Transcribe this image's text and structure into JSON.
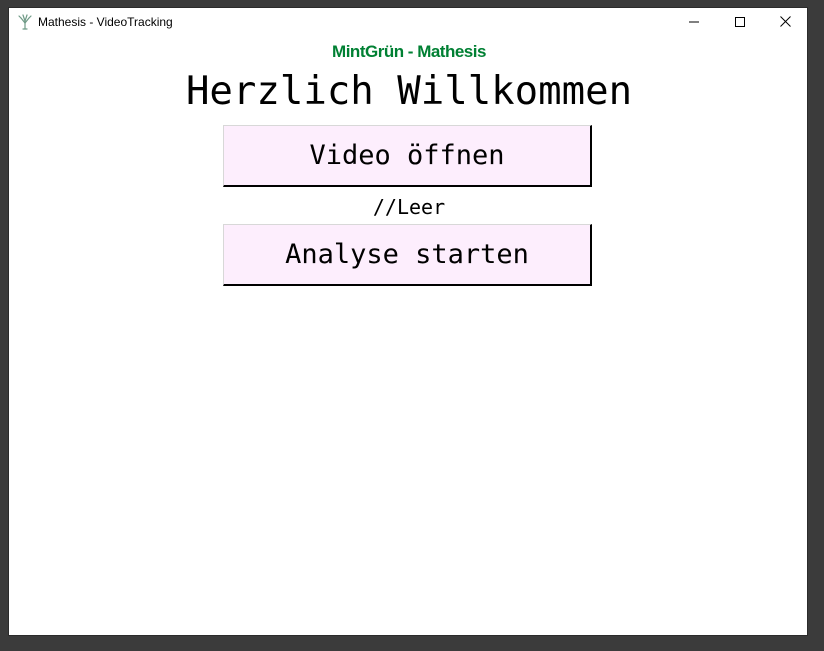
{
  "window": {
    "title": "Mathesis - VideoTracking",
    "app_icon": "tree-icon",
    "controls": {
      "minimize_icon": "minimize-icon",
      "maximize_icon": "maximize-icon",
      "close_icon": "close-icon"
    }
  },
  "main": {
    "brand": "MintGrün - Mathesis",
    "brand_color": "#008033",
    "welcome": "Herzlich Willkommen",
    "open_video_label": "Video öffnen",
    "file_status": "//Leer",
    "start_analysis_label": "Analyse starten",
    "button_color": "#fdeefd"
  }
}
